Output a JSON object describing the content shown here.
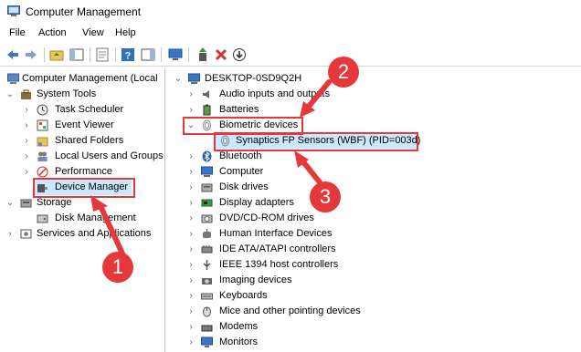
{
  "window": {
    "title": "Computer Management"
  },
  "menu": [
    "File",
    "Action",
    "View",
    "Help"
  ],
  "toolbar_icons": [
    "back-icon",
    "forward-icon",
    "folder-up-icon",
    "show-hide-tree-icon",
    "properties-icon",
    "help-icon",
    "panel-icon",
    "monitor-icon",
    "update-driver-icon",
    "uninstall-icon",
    "scan-icon"
  ],
  "left_tree": {
    "root": "Computer Management (Local",
    "system_tools": "System Tools",
    "task_scheduler": "Task Scheduler",
    "event_viewer": "Event Viewer",
    "shared_folders": "Shared Folders",
    "local_users": "Local Users and Groups",
    "performance": "Performance",
    "device_manager": "Device Manager",
    "storage": "Storage",
    "disk_management": "Disk Management",
    "services": "Services and Applications"
  },
  "right_tree": {
    "computer": "DESKTOP-0SD9Q2H",
    "items": [
      "Audio inputs and outputs",
      "Batteries",
      "Biometric devices",
      "Synaptics FP Sensors (WBF) (PID=003d)",
      "Bluetooth",
      "Computer",
      "Disk drives",
      "Display adapters",
      "DVD/CD-ROM drives",
      "Human Interface Devices",
      "IDE ATA/ATAPI controllers",
      "IEEE 1394 host controllers",
      "Imaging devices",
      "Keyboards",
      "Mice and other pointing devices",
      "Modems",
      "Monitors"
    ]
  },
  "annotations": {
    "step1": "1",
    "step2": "2",
    "step3": "3"
  },
  "colors": {
    "annotation": "#e5383b",
    "selection": "#cce8ff"
  }
}
